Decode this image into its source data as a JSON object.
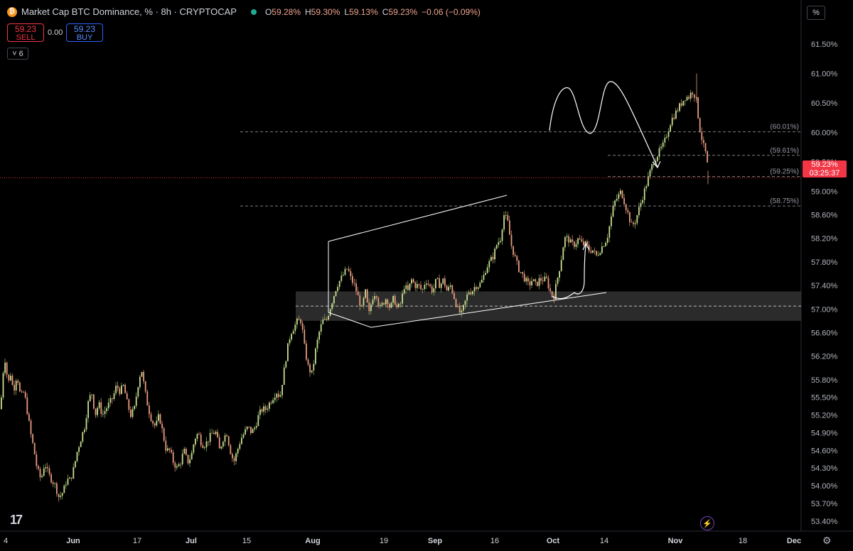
{
  "header": {
    "coin_symbol": "₿",
    "title": "Market Cap BTC Dominance, % · 8h · CRYPTOCAP",
    "ohlc": {
      "o_label": "O",
      "o": "59.28%",
      "h_label": "H",
      "h": "59.30%",
      "l_label": "L",
      "l": "59.13%",
      "c_label": "C",
      "c": "59.23%",
      "change": "−0.06 (−0.09%)"
    }
  },
  "trade": {
    "sell_price": "59.23",
    "sell_label": "SELL",
    "spread": "0.00",
    "buy_price": "59.23",
    "buy_label": "BUY"
  },
  "indicators_toggle": {
    "chevron": "˅",
    "count": "6"
  },
  "scale_mode": "%",
  "last_price": {
    "value": "59.23%",
    "countdown": "03:25:37"
  },
  "brand": "17",
  "settings_icon": "⚙",
  "flash_icon": "⚡",
  "colors": {
    "up": "#c9dd8f",
    "down": "#e89a7e",
    "wick_up": "#22ab94",
    "level": "#7d7d7d",
    "lastline": "#f23645"
  },
  "chart_data": {
    "type": "candlestick",
    "title": "Market Cap BTC Dominance, % · 8h · CRYPTOCAP",
    "y_unit": "%",
    "ylim": [
      53.35,
      61.85
    ],
    "y_ticks": [
      "61.50%",
      "61.00%",
      "60.50%",
      "60.00%",
      "59.50%",
      "59.00%",
      "58.60%",
      "58.20%",
      "57.80%",
      "57.40%",
      "57.00%",
      "56.60%",
      "56.20%",
      "55.80%",
      "55.50%",
      "55.20%",
      "54.90%",
      "54.60%",
      "54.30%",
      "54.00%",
      "53.70%",
      "53.40%"
    ],
    "x_ticks": [
      "4",
      "Jun",
      "17",
      "Jul",
      "15",
      "Aug",
      "19",
      "Sep",
      "16",
      "Oct",
      "14",
      "Nov",
      "18",
      "Dec"
    ],
    "levels": [
      {
        "label": "(60.01%)",
        "value": 60.01
      },
      {
        "label": "(59.61%)",
        "value": 59.61
      },
      {
        "label": "(59.25%)",
        "value": 59.25
      },
      {
        "label": "(58.75%)",
        "value": 58.75
      }
    ],
    "last_value": 59.23,
    "support_zone": [
      56.8,
      57.3
    ],
    "series_path": [
      [
        0,
        55.3
      ],
      [
        3,
        55.9
      ],
      [
        7,
        56.2
      ],
      [
        10,
        55.7
      ],
      [
        14,
        55.9
      ],
      [
        18,
        55.6
      ],
      [
        23,
        55.9
      ],
      [
        28,
        55.5
      ],
      [
        33,
        55.6
      ],
      [
        37,
        55.3
      ],
      [
        42,
        54.9
      ],
      [
        47,
        54.6
      ],
      [
        51,
        54.3
      ],
      [
        57,
        54.1
      ],
      [
        62,
        54.4
      ],
      [
        67,
        54.2
      ],
      [
        72,
        54.1
      ],
      [
        77,
        54.0
      ],
      [
        82,
        53.8
      ],
      [
        88,
        53.9
      ],
      [
        93,
        54.1
      ],
      [
        98,
        54.1
      ],
      [
        103,
        54.3
      ],
      [
        108,
        54.6
      ],
      [
        113,
        54.8
      ],
      [
        118,
        55.0
      ],
      [
        123,
        55.4
      ],
      [
        128,
        55.6
      ],
      [
        133,
        55.2
      ],
      [
        138,
        55.4
      ],
      [
        143,
        55.2
      ],
      [
        148,
        55.3
      ],
      [
        153,
        55.4
      ],
      [
        158,
        55.5
      ],
      [
        163,
        55.7
      ],
      [
        168,
        55.6
      ],
      [
        173,
        55.7
      ],
      [
        178,
        55.4
      ],
      [
        183,
        55.2
      ],
      [
        188,
        55.3
      ],
      [
        193,
        55.7
      ],
      [
        198,
        56.0
      ],
      [
        203,
        55.6
      ],
      [
        208,
        55.3
      ],
      [
        213,
        55.1
      ],
      [
        218,
        55.0
      ],
      [
        223,
        55.2
      ],
      [
        228,
        54.9
      ],
      [
        233,
        54.6
      ],
      [
        238,
        54.6
      ],
      [
        243,
        54.4
      ],
      [
        248,
        54.3
      ],
      [
        253,
        54.4
      ],
      [
        258,
        54.6
      ],
      [
        263,
        54.4
      ],
      [
        268,
        54.5
      ],
      [
        273,
        54.8
      ],
      [
        278,
        54.9
      ],
      [
        283,
        54.7
      ],
      [
        288,
        54.7
      ],
      [
        293,
        54.8
      ],
      [
        298,
        54.9
      ],
      [
        303,
        54.9
      ],
      [
        308,
        54.6
      ],
      [
        313,
        54.8
      ],
      [
        318,
        54.9
      ],
      [
        323,
        54.6
      ],
      [
        328,
        54.4
      ],
      [
        333,
        54.6
      ],
      [
        338,
        54.8
      ],
      [
        343,
        54.9
      ],
      [
        348,
        55.0
      ],
      [
        353,
        54.9
      ],
      [
        358,
        55.0
      ],
      [
        363,
        55.2
      ],
      [
        368,
        55.3
      ],
      [
        373,
        55.3
      ],
      [
        378,
        55.4
      ],
      [
        383,
        55.5
      ],
      [
        388,
        55.6
      ],
      [
        393,
        55.5
      ],
      [
        398,
        55.9
      ],
      [
        403,
        56.3
      ],
      [
        408,
        56.6
      ],
      [
        413,
        56.7
      ],
      [
        418,
        56.8
      ],
      [
        423,
        56.8
      ],
      [
        428,
        56.3
      ],
      [
        433,
        56.0
      ],
      [
        438,
        55.9
      ],
      [
        443,
        56.3
      ],
      [
        448,
        56.6
      ],
      [
        453,
        56.8
      ],
      [
        458,
        56.8
      ],
      [
        463,
        57.0
      ],
      [
        468,
        57.2
      ],
      [
        473,
        57.4
      ],
      [
        478,
        57.5
      ],
      [
        483,
        57.6
      ],
      [
        488,
        57.7
      ],
      [
        493,
        57.5
      ],
      [
        498,
        57.4
      ],
      [
        503,
        57.2
      ],
      [
        508,
        57.0
      ],
      [
        513,
        57.3
      ],
      [
        518,
        56.9
      ],
      [
        523,
        57.2
      ],
      [
        528,
        57.3
      ],
      [
        533,
        57.0
      ],
      [
        538,
        57.1
      ],
      [
        543,
        57.2
      ],
      [
        548,
        57.0
      ],
      [
        553,
        57.2
      ],
      [
        558,
        57.0
      ],
      [
        563,
        57.1
      ],
      [
        568,
        57.4
      ],
      [
        573,
        57.3
      ],
      [
        578,
        57.5
      ],
      [
        583,
        57.4
      ],
      [
        588,
        57.4
      ],
      [
        593,
        57.3
      ],
      [
        598,
        57.5
      ],
      [
        603,
        57.4
      ],
      [
        608,
        57.3
      ],
      [
        613,
        57.5
      ],
      [
        618,
        57.4
      ],
      [
        623,
        57.5
      ],
      [
        628,
        57.3
      ],
      [
        633,
        57.4
      ],
      [
        638,
        57.2
      ],
      [
        643,
        57.0
      ],
      [
        648,
        56.9
      ],
      [
        653,
        57.1
      ],
      [
        658,
        57.3
      ],
      [
        663,
        57.3
      ],
      [
        668,
        57.4
      ],
      [
        673,
        57.4
      ],
      [
        678,
        57.5
      ],
      [
        683,
        57.7
      ],
      [
        688,
        57.8
      ],
      [
        693,
        57.9
      ],
      [
        698,
        58.1
      ],
      [
        703,
        58.2
      ],
      [
        708,
        58.6
      ],
      [
        713,
        58.5
      ],
      [
        718,
        58.1
      ],
      [
        723,
        57.9
      ],
      [
        728,
        57.7
      ],
      [
        733,
        57.6
      ],
      [
        738,
        57.5
      ],
      [
        743,
        57.4
      ],
      [
        748,
        57.5
      ],
      [
        753,
        57.4
      ],
      [
        758,
        57.5
      ],
      [
        763,
        57.5
      ],
      [
        768,
        57.5
      ],
      [
        773,
        57.3
      ],
      [
        778,
        57.2
      ],
      [
        783,
        57.5
      ],
      [
        788,
        57.8
      ],
      [
        793,
        58.2
      ],
      [
        798,
        58.2
      ],
      [
        803,
        58.1
      ],
      [
        808,
        58.1
      ],
      [
        813,
        58.2
      ],
      [
        818,
        58.1
      ],
      [
        823,
        58.1
      ],
      [
        828,
        58.0
      ],
      [
        833,
        58.0
      ],
      [
        838,
        57.9
      ],
      [
        843,
        58.0
      ],
      [
        848,
        58.1
      ],
      [
        853,
        58.2
      ],
      [
        858,
        58.5
      ],
      [
        863,
        58.8
      ],
      [
        868,
        58.9
      ],
      [
        873,
        59.0
      ],
      [
        878,
        58.8
      ],
      [
        883,
        58.6
      ],
      [
        888,
        58.4
      ],
      [
        893,
        58.5
      ],
      [
        898,
        58.7
      ],
      [
        903,
        58.9
      ],
      [
        908,
        59.1
      ],
      [
        913,
        59.3
      ],
      [
        918,
        59.5
      ],
      [
        923,
        59.6
      ],
      [
        928,
        59.7
      ],
      [
        933,
        59.8
      ],
      [
        938,
        60.0
      ],
      [
        943,
        60.2
      ],
      [
        948,
        60.3
      ],
      [
        953,
        60.4
      ],
      [
        958,
        60.5
      ],
      [
        963,
        60.6
      ],
      [
        968,
        60.6
      ],
      [
        973,
        60.7
      ],
      [
        978,
        60.6
      ],
      [
        983,
        60.1
      ],
      [
        988,
        59.8
      ],
      [
        993,
        59.6
      ],
      [
        996,
        59.23
      ]
    ]
  }
}
